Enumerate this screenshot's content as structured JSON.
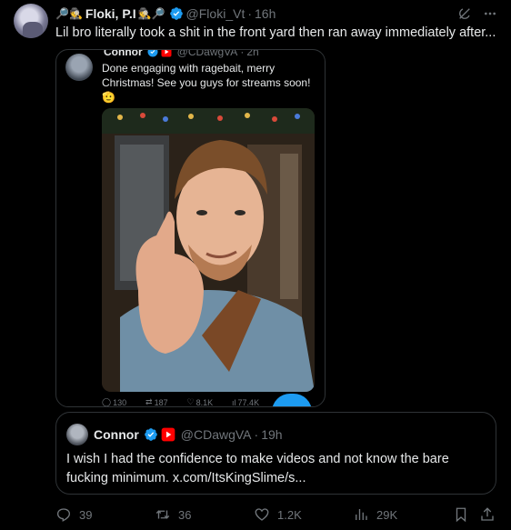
{
  "tweet": {
    "author": {
      "name_prefix_emojis": "🔎🕵",
      "display_name": "Floki, P.I",
      "name_suffix_emojis": "🕵🔎",
      "handle": "@Floki_Vt",
      "time": "16h"
    },
    "text": "Lil bro literally took a shit in the front yard then ran away immediately after...",
    "embedded_post": {
      "display_name": "Connor",
      "handle": "@CDawgVA",
      "time": "2h",
      "text": "Done engaging with ragebait, merry Christmas! See you guys for streams soon! 🫡",
      "stats": {
        "replies": "130",
        "reposts": "187",
        "likes": "8.1K",
        "views": "77.4K"
      }
    },
    "quoted": {
      "display_name": "Connor",
      "handle": "@CDawgVA",
      "time": "19h",
      "text": "I wish I had the confidence to make videos and not know the bare fucking minimum. x.com/ItsKingSlime/s..."
    },
    "actions": {
      "replies": "39",
      "reposts": "36",
      "likes": "1.2K",
      "views": "29K"
    },
    "icons": {
      "grok": "grok-icon",
      "more": "more-icon",
      "verified": "verified-badge-icon",
      "youtube": "youtube-badge-icon",
      "reply": "reply-icon",
      "repost": "repost-icon",
      "like": "like-icon",
      "views": "views-icon",
      "bookmark": "bookmark-icon",
      "share": "share-icon"
    },
    "colors": {
      "background": "#000000",
      "text": "#e7e9ea",
      "muted": "#71767b",
      "border": "#2f3336",
      "accent": "#1d9bf0",
      "youtube": "#ff0000"
    }
  }
}
